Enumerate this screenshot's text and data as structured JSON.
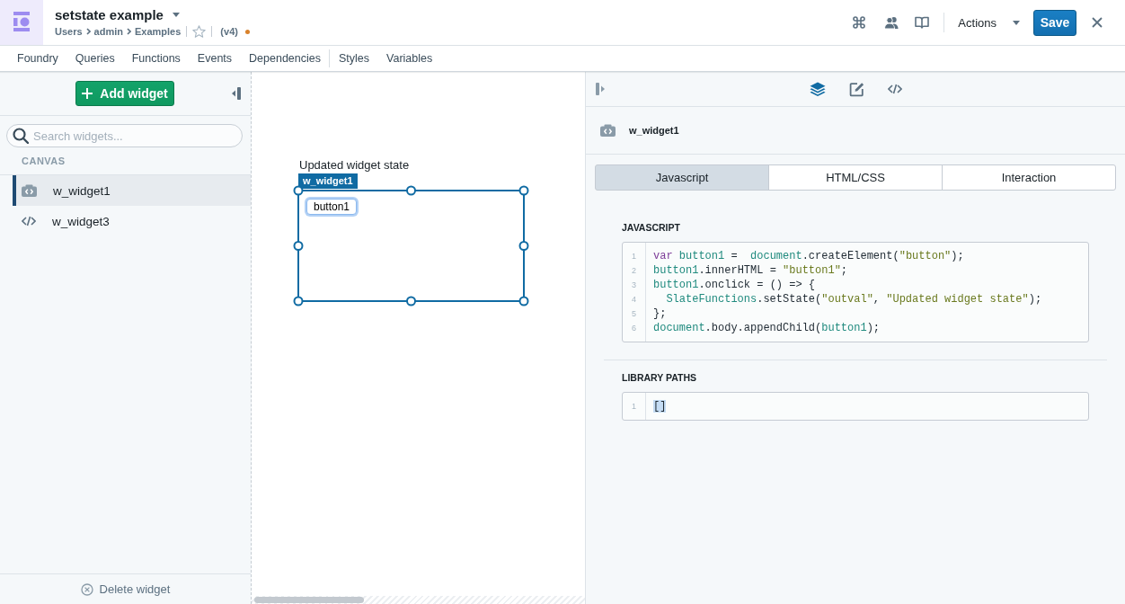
{
  "app": {
    "title": "setstate example",
    "breadcrumb": [
      "Users",
      "admin",
      "Examples"
    ],
    "starred": false,
    "version": "(v4)",
    "unsaved": true
  },
  "toolbar": {
    "actions": "Actions",
    "save": "Save"
  },
  "menu_groups": [
    [
      "Foundry",
      "Queries",
      "Functions",
      "Events",
      "Dependencies"
    ],
    [
      "Styles",
      "Variables"
    ]
  ],
  "sidebar": {
    "add_button": "Add widget",
    "search": {
      "placeholder": "Search widgets..."
    },
    "section": "CANVAS",
    "items": [
      {
        "label": "w_widget1",
        "kind": "sandbox",
        "selected": true
      },
      {
        "label": "w_widget3",
        "kind": "html",
        "selected": false
      }
    ],
    "delete_button": "Delete widget"
  },
  "canvas": {
    "state_text": "Updated widget state",
    "widget": {
      "label": "w_widget1",
      "selected": true,
      "button": "button1"
    }
  },
  "panel": {
    "views": [
      {
        "selected": true
      },
      {
        "selected": false
      },
      {
        "selected": false
      }
    ],
    "widget": {
      "label": "w_widget1",
      "kind": "sandbox"
    },
    "tabs": [
      {
        "label": "Javascript",
        "selected": true
      },
      {
        "label": "HTML/CSS",
        "selected": false
      },
      {
        "label": "Interaction",
        "selected": false
      }
    ],
    "javascript": {
      "label": "JAVASCRIPT",
      "lines": [
        {
          "number": "1",
          "tokens": [
            {
              "text": "var ",
              "kind": "keyword"
            },
            {
              "text": "button1",
              "kind": "variable"
            },
            {
              "text": " =  ",
              "kind": "plain"
            },
            {
              "text": "document",
              "kind": "variable"
            },
            {
              "text": ".createElement(",
              "kind": "plain"
            },
            {
              "text": "\"button\"",
              "kind": "string"
            },
            {
              "text": ");",
              "kind": "plain"
            }
          ]
        },
        {
          "number": "2",
          "tokens": [
            {
              "text": "button1",
              "kind": "variable"
            },
            {
              "text": ".innerHTML = ",
              "kind": "plain"
            },
            {
              "text": "\"button1\"",
              "kind": "string"
            },
            {
              "text": ";",
              "kind": "plain"
            }
          ]
        },
        {
          "number": "3",
          "tokens": [
            {
              "text": "button1",
              "kind": "variable"
            },
            {
              "text": ".onclick = () => {",
              "kind": "plain"
            }
          ]
        },
        {
          "number": "4",
          "tokens": [
            {
              "text": "  SlateFunctions",
              "kind": "variable"
            },
            {
              "text": ".setState(",
              "kind": "plain"
            },
            {
              "text": "\"outval\"",
              "kind": "string"
            },
            {
              "text": ", ",
              "kind": "plain"
            },
            {
              "text": "\"Updated widget state\"",
              "kind": "string"
            },
            {
              "text": ");",
              "kind": "plain"
            }
          ]
        },
        {
          "number": "5",
          "tokens": [
            {
              "text": "};",
              "kind": "plain"
            }
          ]
        },
        {
          "number": "6",
          "tokens": [
            {
              "text": "document",
              "kind": "variable"
            },
            {
              "text": ".body.appendChild(",
              "kind": "plain"
            },
            {
              "text": "button1",
              "kind": "variable"
            },
            {
              "text": ");",
              "kind": "plain"
            }
          ]
        }
      ]
    },
    "library_paths": {
      "label": "LIBRARY PATHS",
      "lines": [
        {
          "number": "1",
          "tokens": [
            {
              "text": "[]",
              "kind": "bracket"
            }
          ]
        }
      ]
    }
  }
}
